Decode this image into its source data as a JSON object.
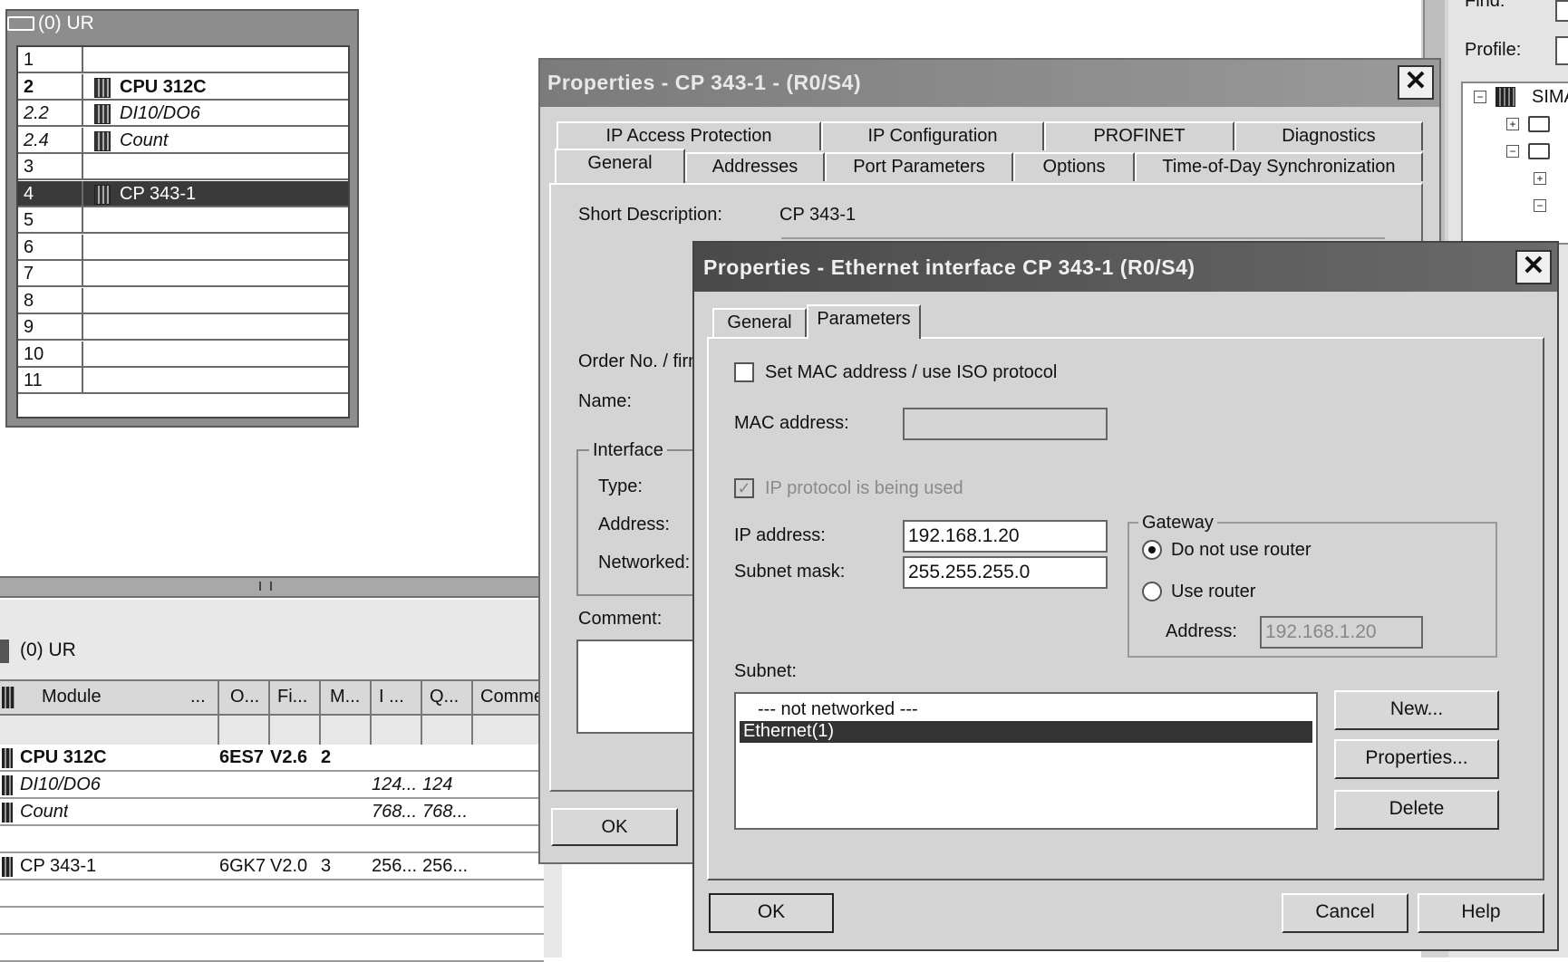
{
  "rack": {
    "title": "(0) UR",
    "rows": [
      {
        "slot": "1",
        "module": ""
      },
      {
        "slot": "2",
        "module": "CPU 312C"
      },
      {
        "slot": "2.2",
        "module": "DI10/DO6"
      },
      {
        "slot": "2.4",
        "module": "Count"
      },
      {
        "slot": "3",
        "module": ""
      },
      {
        "slot": "4",
        "module": "CP 343-1"
      },
      {
        "slot": "5",
        "module": ""
      },
      {
        "slot": "6",
        "module": ""
      },
      {
        "slot": "7",
        "module": ""
      },
      {
        "slot": "8",
        "module": ""
      },
      {
        "slot": "9",
        "module": ""
      },
      {
        "slot": "10",
        "module": ""
      },
      {
        "slot": "11",
        "module": ""
      }
    ]
  },
  "detail_table": {
    "title": "(0)  UR",
    "headers": [
      "Module",
      "...",
      "O...",
      "Fi...",
      "M...",
      "I ...",
      "Q...",
      "Comme"
    ],
    "rows": [
      {
        "module": "CPU 312C",
        "order": "6ES7",
        "firmware": "V2.6",
        "mpi": "2",
        "i": "",
        "q": ""
      },
      {
        "module": "DI10/DO6",
        "order": "",
        "firmware": "",
        "mpi": "",
        "i": "124...",
        "q": "124"
      },
      {
        "module": "Count",
        "order": "",
        "firmware": "",
        "mpi": "",
        "i": "768...",
        "q": "768..."
      },
      {
        "module": "CP 343-1",
        "order": "6GK7",
        "firmware": "V2.0",
        "mpi": "3",
        "i": "256...",
        "q": "256..."
      }
    ]
  },
  "catalog": {
    "find_label": "Find:",
    "profile_label": "Profile:",
    "tree_root": "SIMA"
  },
  "cp_dialog": {
    "title": "Properties - CP 343-1 - (R0/S4)",
    "tabs_row1": [
      "IP Access Protection",
      "IP Configuration",
      "PROFINET",
      "Diagnostics"
    ],
    "tabs_row2": [
      "General",
      "Addresses",
      "Port Parameters",
      "Options",
      "Time-of-Day Synchronization"
    ],
    "short_description_label": "Short Description:",
    "short_description_value": "CP 343-1",
    "order_no_label": "Order No. / firm",
    "name_label": "Name:",
    "interface_group": "Interface",
    "type_label": "Type:",
    "address_label": "Address:",
    "networked_label": "Networked:",
    "comment_label": "Comment:",
    "ok_label": "OK"
  },
  "eth_dialog": {
    "title": "Properties - Ethernet interface  CP 343-1 (R0/S4)",
    "tabs": [
      "General",
      "Parameters"
    ],
    "set_mac_label": "Set MAC address / use ISO protocol",
    "set_mac_checked": false,
    "mac_address_label": "MAC address:",
    "mac_address_value": "",
    "ip_used_label": "IP protocol is being used",
    "ip_used_checked": true,
    "ip_address_label": "IP address:",
    "ip_address_value": "192.168.1.20",
    "subnet_mask_label": "Subnet mask:",
    "subnet_mask_value": "255.255.255.0",
    "gateway_group": "Gateway",
    "no_router_label": "Do not use router",
    "use_router_label": "Use router",
    "router_selected": "Do not use router",
    "router_address_label": "Address:",
    "router_address_value": "192.168.1.20",
    "subnet_label": "Subnet:",
    "subnet_items": [
      "--- not networked ---",
      "Ethernet(1)"
    ],
    "subnet_selected": "Ethernet(1)",
    "new_label": "New...",
    "properties_label": "Properties...",
    "delete_label": "Delete",
    "ok_label": "OK",
    "cancel_label": "Cancel",
    "help_label": "Help"
  }
}
